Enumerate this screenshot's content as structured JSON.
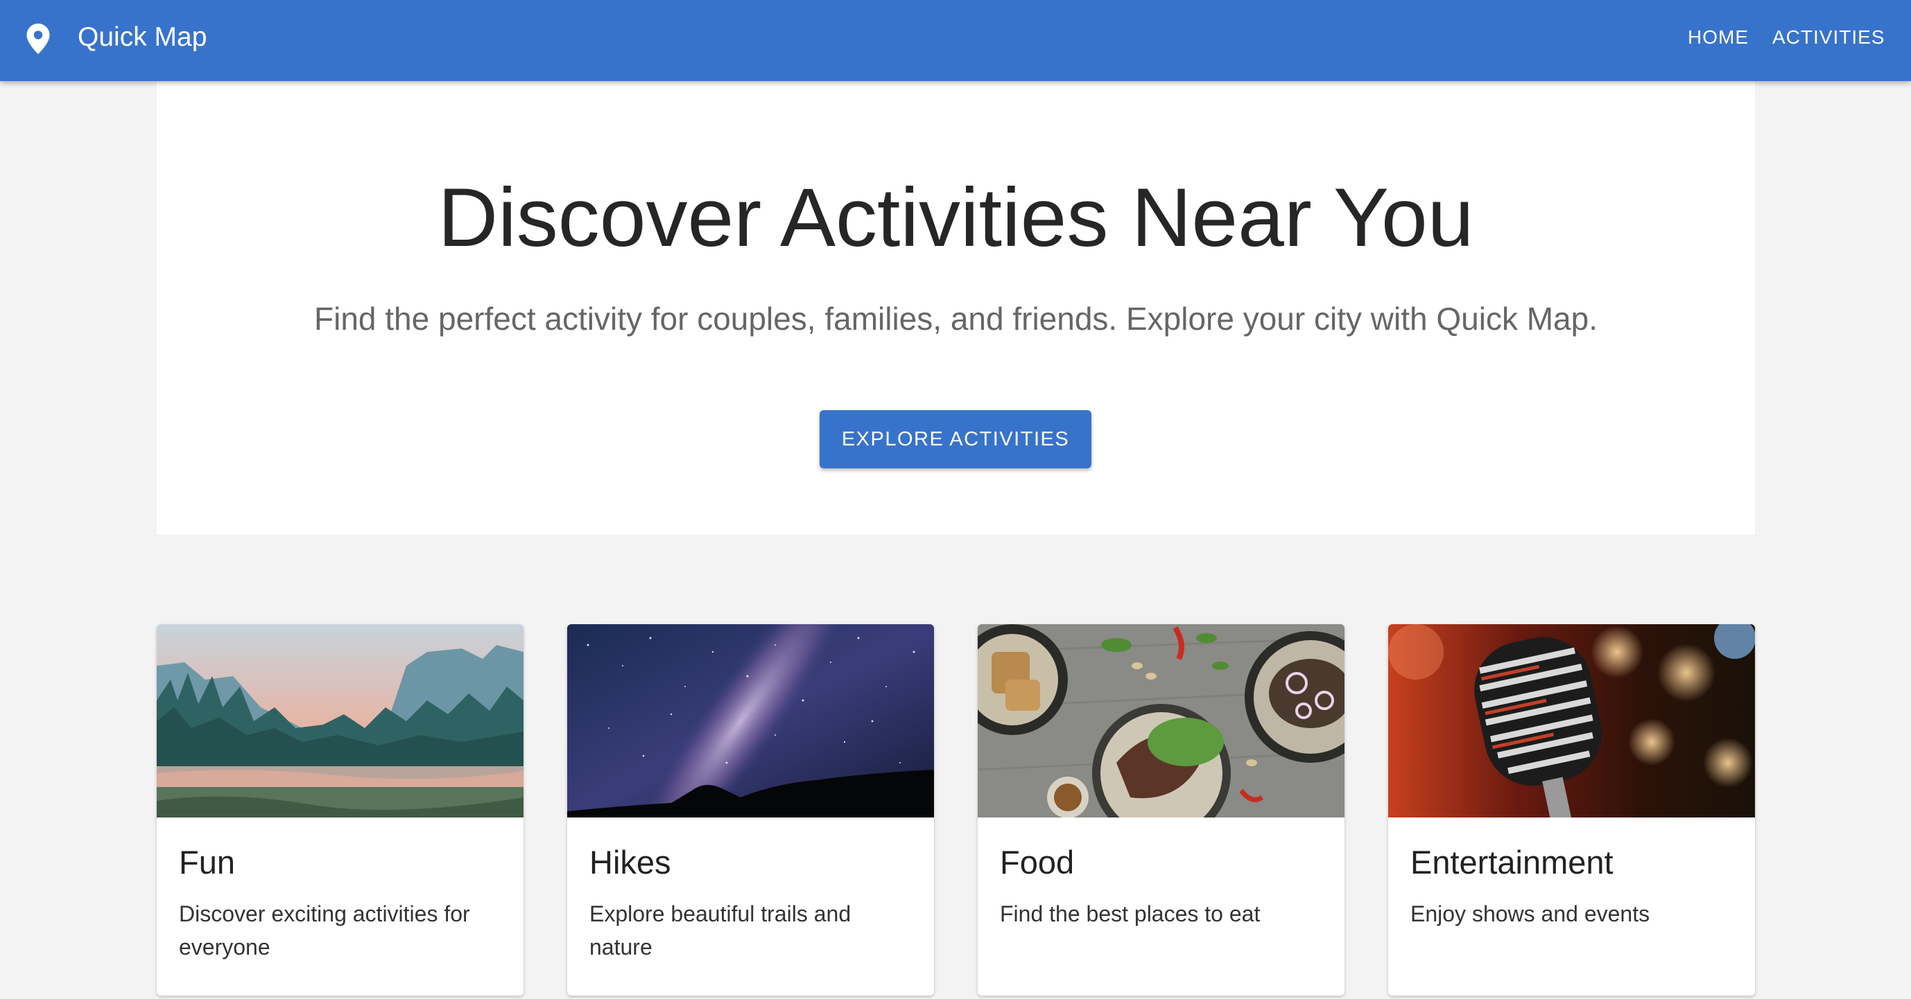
{
  "appbar": {
    "brand": "Quick Map",
    "nav": [
      "HOME",
      "ACTIVITIES"
    ]
  },
  "hero": {
    "title": "Discover Activities Near You",
    "subtitle": "Find the perfect activity for couples, families, and friends. Explore your city with Quick Map.",
    "cta": "EXPLORE ACTIVITIES"
  },
  "cards": [
    {
      "title": "Fun",
      "description": "Discover exciting activities for everyone",
      "image": "mountain-valley-river-photo"
    },
    {
      "title": "Hikes",
      "description": "Explore beautiful trails and nature",
      "image": "milky-way-night-sky-photo"
    },
    {
      "title": "Food",
      "description": "Find the best places to eat",
      "image": "plated-dishes-table-photo"
    },
    {
      "title": "Entertainment",
      "description": "Enjoy shows and events",
      "image": "vintage-microphone-stage-photo"
    }
  ],
  "colors": {
    "primary": "#3873cb",
    "background": "#f3f3f3",
    "surface": "#ffffff"
  }
}
